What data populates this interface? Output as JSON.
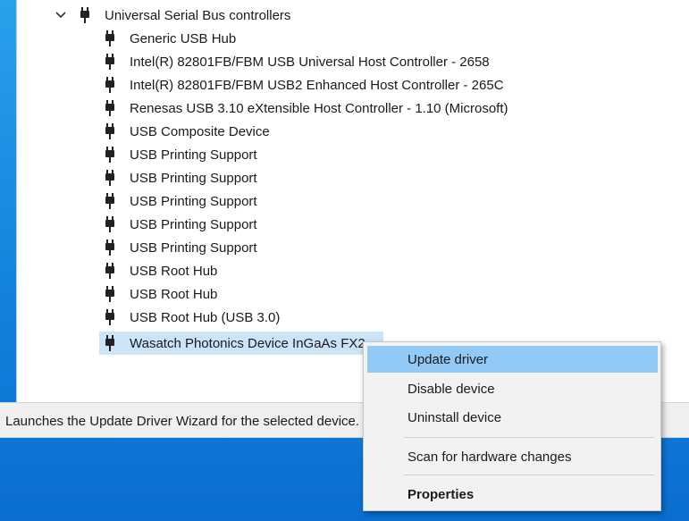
{
  "tree": {
    "parent_label": "Universal Serial Bus controllers",
    "children": [
      {
        "label": "Generic USB Hub"
      },
      {
        "label": "Intel(R) 82801FB/FBM USB Universal Host Controller - 2658"
      },
      {
        "label": "Intel(R) 82801FB/FBM USB2 Enhanced Host Controller - 265C"
      },
      {
        "label": "Renesas USB 3.10 eXtensible Host Controller - 1.10 (Microsoft)"
      },
      {
        "label": "USB Composite Device"
      },
      {
        "label": "USB Printing Support"
      },
      {
        "label": "USB Printing Support"
      },
      {
        "label": "USB Printing Support"
      },
      {
        "label": "USB Printing Support"
      },
      {
        "label": "USB Printing Support"
      },
      {
        "label": "USB Root Hub"
      },
      {
        "label": "USB Root Hub"
      },
      {
        "label": "USB Root Hub (USB 3.0)"
      },
      {
        "label": "Wasatch Photonics Device InGaAs FX2"
      }
    ]
  },
  "status_bar": {
    "text": "Launches the Update Driver Wizard for the selected device."
  },
  "context_menu": {
    "items": [
      {
        "label": "Update driver"
      },
      {
        "label": "Disable device"
      },
      {
        "label": "Uninstall device"
      },
      {
        "label": "Scan for hardware changes"
      },
      {
        "label": "Properties"
      }
    ]
  },
  "colors": {
    "selection": "#cce4f7",
    "menu_highlight": "#91c9f7",
    "desktop_blue": "#1483dc"
  },
  "icons": {
    "expand": "chevron-down-icon",
    "device": "usb-plug-icon"
  }
}
